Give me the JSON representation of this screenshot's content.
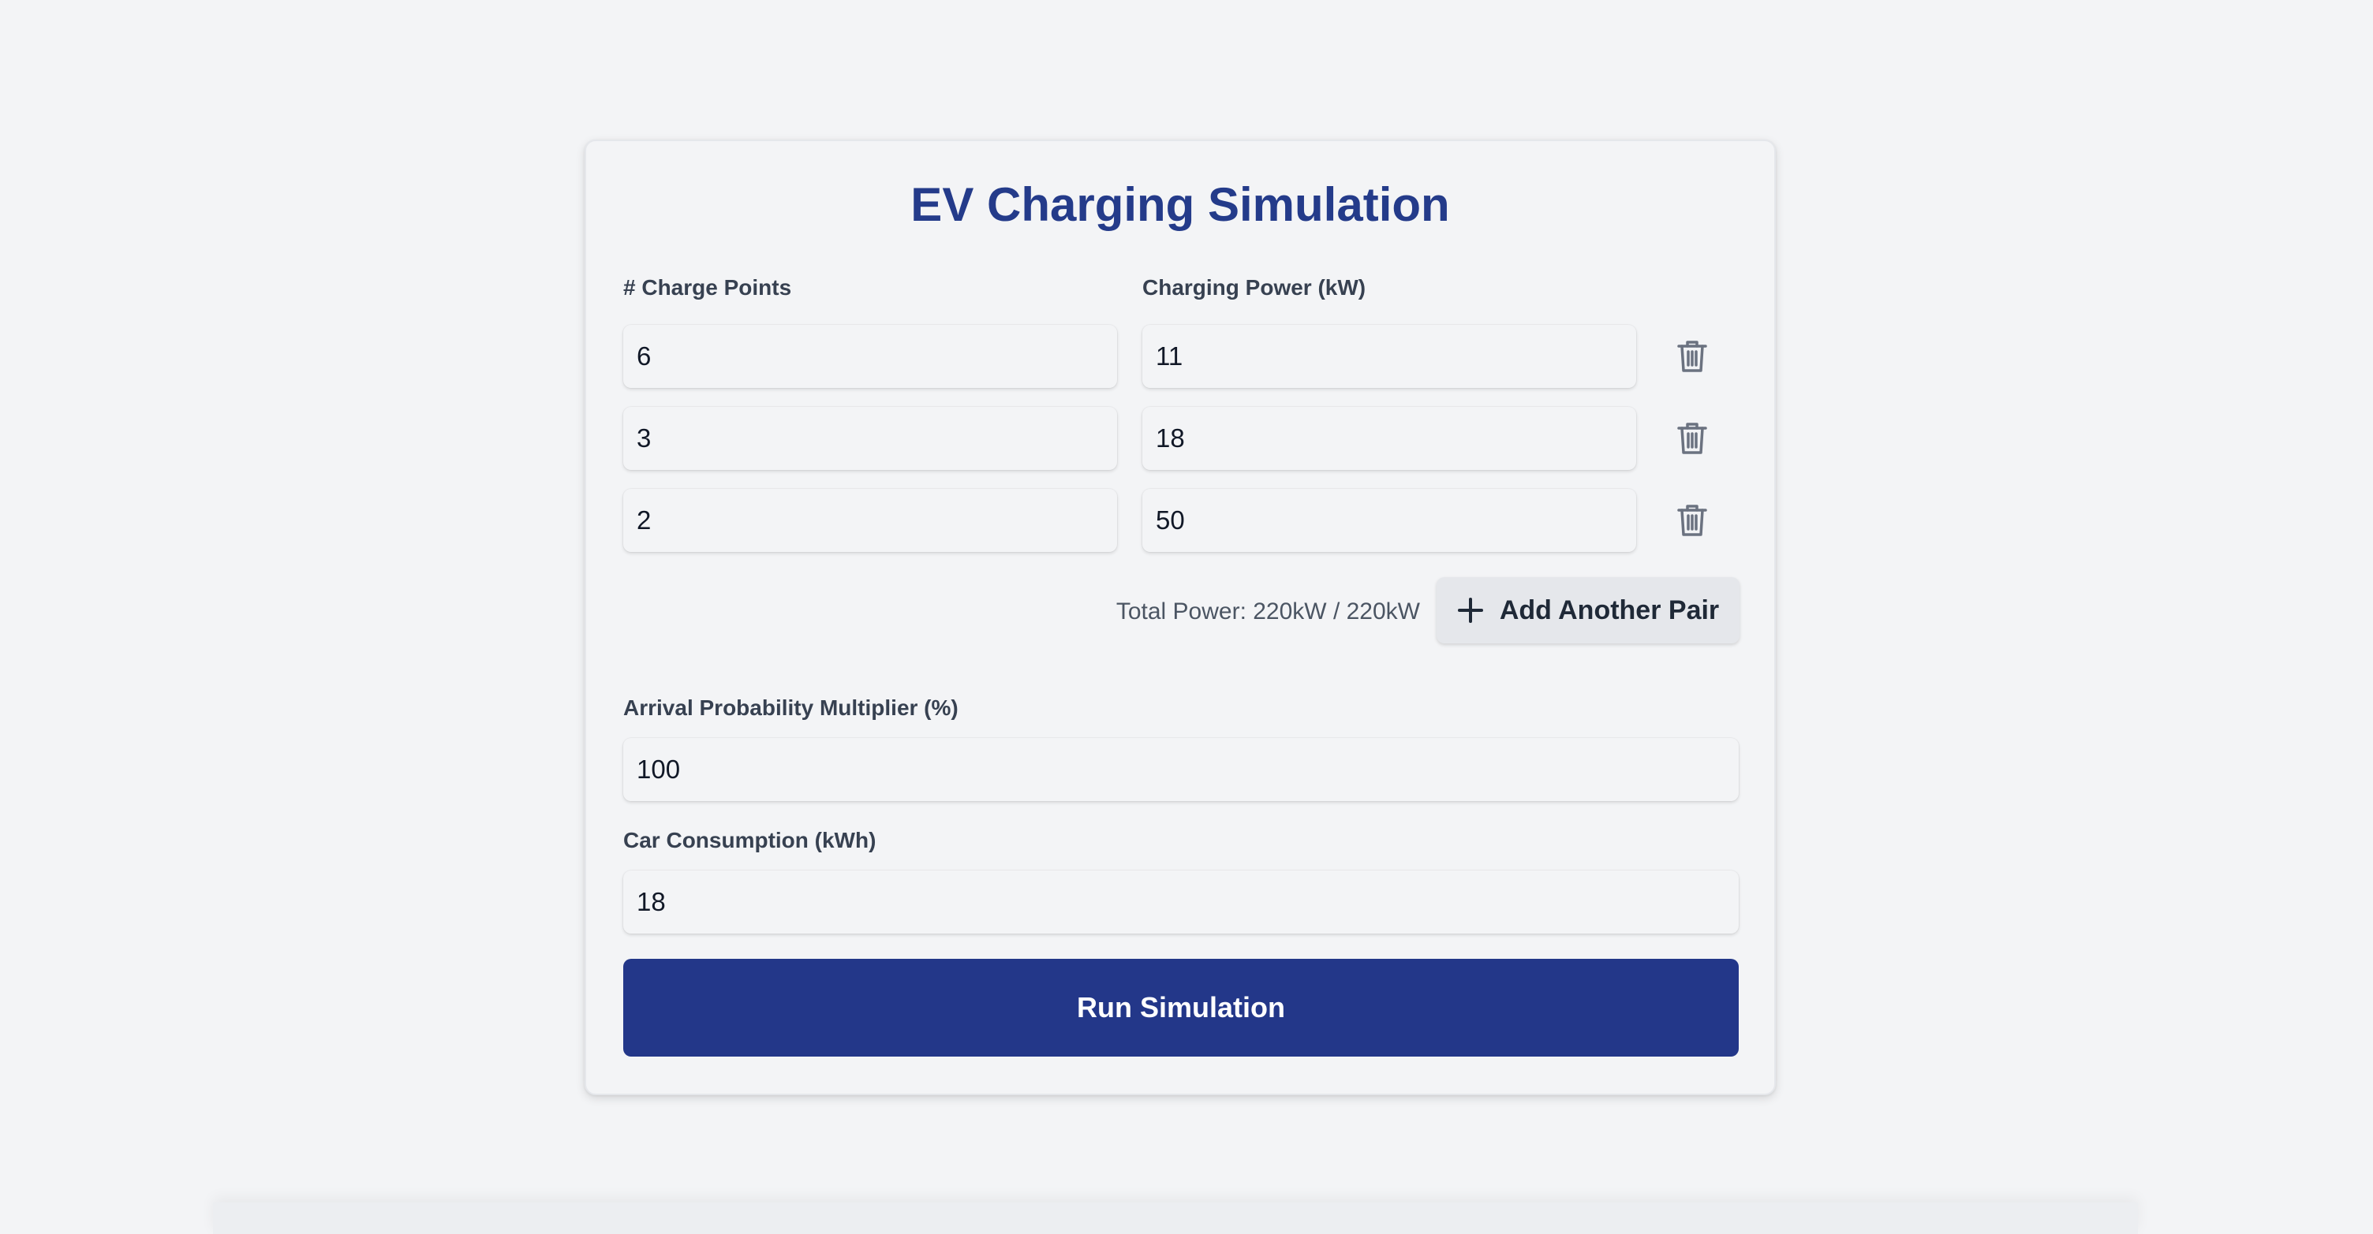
{
  "title": "EV Charging Simulation",
  "pairs_section": {
    "charge_points_label": "# Charge Points",
    "charging_power_label": "Charging Power (kW)",
    "rows": [
      {
        "charge_points": "6",
        "power": "11"
      },
      {
        "charge_points": "3",
        "power": "18"
      },
      {
        "charge_points": "2",
        "power": "50"
      }
    ],
    "total_power_text": "Total Power: 220kW / 220kW",
    "add_pair_label": "Add Another Pair"
  },
  "arrival": {
    "label": "Arrival Probability Multiplier (%)",
    "value": "100"
  },
  "consumption": {
    "label": "Car Consumption (kWh)",
    "value": "18"
  },
  "run_button_label": "Run Simulation",
  "colors": {
    "accent": "#233789",
    "title": "#243b8a",
    "background": "#f3f4f6",
    "icon": "#6b7280"
  },
  "icons": {
    "delete": "trash-icon",
    "add": "plus-icon"
  }
}
